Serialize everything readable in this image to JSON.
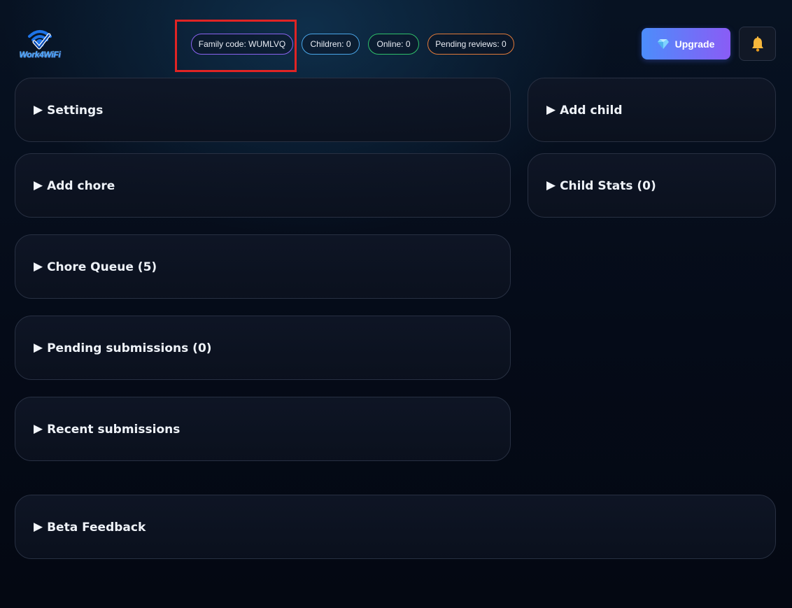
{
  "logo": {
    "text": "Work4WiFi"
  },
  "header": {
    "family_code": "Family code: WUMLVQ",
    "children": "Children: 0",
    "online": "Online: 0",
    "pending_reviews": "Pending reviews: 0",
    "upgrade_label": "Upgrade",
    "upgrade_icon": "gem-icon",
    "notifications_icon": "bell-icon"
  },
  "colors": {
    "family_border": "#8a63f0",
    "children_border": "#4aa6e8",
    "online_border": "#2fbf6a",
    "pending_border": "#e07a3a",
    "highlight": "#e02424",
    "upgrade_gradient": [
      "#4c8dfb",
      "#8a5cf5"
    ]
  },
  "sections": {
    "settings": "Settings",
    "add_chore": "Add chore",
    "chore_queue": "Chore Queue (5)",
    "pending_submissions": "Pending submissions (0)",
    "recent_submissions": "Recent submissions",
    "add_child": "Add child",
    "child_stats": "Child Stats (0)",
    "beta_feedback": "Beta Feedback"
  },
  "expand_glyph": "▶"
}
